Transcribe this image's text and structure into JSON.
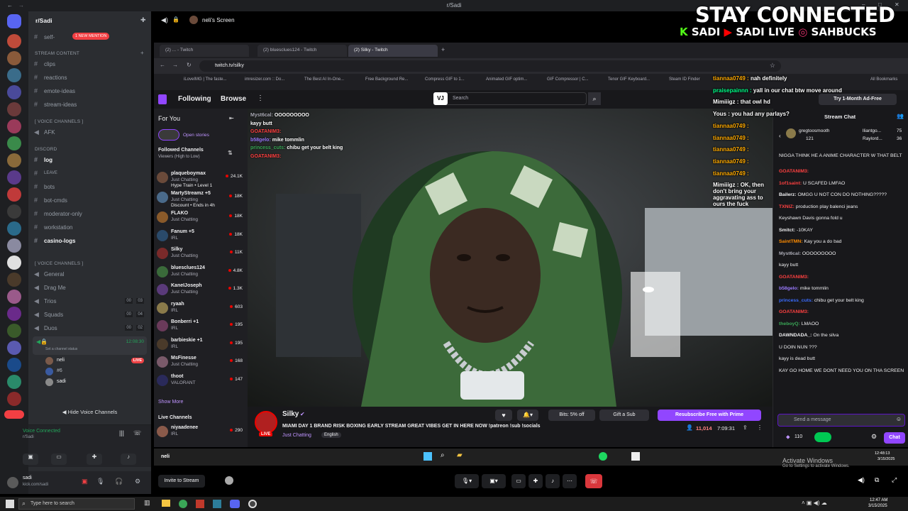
{
  "window": {
    "title": "r/Sadi"
  },
  "server": {
    "name": "r/Sadi",
    "mention_badge": "1 NEW MENTION"
  },
  "channels": {
    "self": "self-",
    "stream_content_category": "Stream Content",
    "stream_content": [
      "clips",
      "reactions",
      "emote-ideas",
      "stream-ideas"
    ],
    "voice_cat_1": "[ VOICE CHANNELS ]",
    "afk": "AFK",
    "discord_category": "Discord",
    "discord_items": [
      "log",
      "LEAVE",
      "bots",
      "bot-cmds",
      "moderator-only",
      "workstation",
      "casino-logs"
    ],
    "voice_cat_2": "[ VOICE CHANNELS ]",
    "voice_items": [
      {
        "name": "General",
        "counts": [
          "",
          ""
        ]
      },
      {
        "name": "Drag Me",
        "counts": [
          "",
          ""
        ]
      },
      {
        "name": "Trios",
        "counts": [
          "00",
          "03"
        ]
      },
      {
        "name": "Squads",
        "counts": [
          "00",
          "04"
        ]
      },
      {
        "name": "Duos",
        "counts": [
          "00",
          "02"
        ]
      }
    ],
    "locked_timer": "12:08:30",
    "set_status": "Set a channel status",
    "members": [
      {
        "name": "neli",
        "live": "LIVE"
      },
      {
        "name": "#6"
      },
      {
        "name": "sadi"
      }
    ],
    "hide_voice": "Hide Voice Channels",
    "voice_connected": "Voice Connected",
    "voice_server": "r/Sadi",
    "user_name": "sadi",
    "user_status": "kick.com/sadi"
  },
  "stage": {
    "screen_title": "neli's Screen",
    "stream_label": "neli",
    "invite": "Invite to Stream"
  },
  "overlay": {
    "headline": "STAY CONNECTED",
    "links": [
      "SADI",
      "SADI LIVE",
      "SAHBUCKS"
    ]
  },
  "browser": {
    "tabs": [
      "(2) ... - Twitch",
      "(2) bluesclues124 - Twitch",
      "(2) Silky - Twitch"
    ],
    "url": "twitch.tv/silky",
    "bookmarks": [
      "iLoveIMG | The faste...",
      "imresizer.com :: Do...",
      "The Best AI In-One...",
      "Free Background Re...",
      "Compress GIF to 1...",
      "Animated GIF optim...",
      "GIF Compressor | C...",
      "Tenor GIF Keyboard...",
      "Steam ID Finder",
      "All Bookmarks"
    ]
  },
  "twitch": {
    "nav": {
      "following": "Following",
      "browse": "Browse",
      "search": "Search",
      "ad_free": "Try 1-Month Ad-Free"
    },
    "for_you": "For You",
    "open_stories": "Open stories",
    "followed": "Followed Channels",
    "sort": "Viewers (High to Low)",
    "follows": [
      {
        "name": "plaqueboymax",
        "game": "Just Chatting",
        "extra": "Hype Train • Level 1",
        "viewers": "24.1K"
      },
      {
        "name": "MartyStreamz +5",
        "game": "Just Chatting",
        "extra": "Discount • Ends in 4h",
        "viewers": "18K"
      },
      {
        "name": "FLAKO",
        "game": "Just Chatting",
        "extra": "",
        "viewers": "18K"
      },
      {
        "name": "Fanum +5",
        "game": "IRL",
        "extra": "",
        "viewers": "18K"
      },
      {
        "name": "Silky",
        "game": "Just Chatting",
        "extra": "",
        "viewers": "11K"
      },
      {
        "name": "bluesclues124",
        "game": "Just Chatting",
        "extra": "",
        "viewers": "4.8K"
      },
      {
        "name": "KaneIJoseph",
        "game": "Just Chatting",
        "extra": "",
        "viewers": "1.3K"
      },
      {
        "name": "ryaah",
        "game": "IRL",
        "extra": "",
        "viewers": "603"
      },
      {
        "name": "Bonberri +1",
        "game": "IRL",
        "extra": "",
        "viewers": "195"
      },
      {
        "name": "barbieskie +1",
        "game": "IRL",
        "extra": "",
        "viewers": "195"
      },
      {
        "name": "MsFinesse",
        "game": "Just Chatting",
        "extra": "",
        "viewers": "168"
      },
      {
        "name": "thoot",
        "game": "VALORANT",
        "extra": "",
        "viewers": "147"
      }
    ],
    "show_more": "Show More",
    "live_channels": "Live Channels",
    "live_first": {
      "name": "niyaadenee",
      "game": "IRL",
      "viewers": "290"
    },
    "video_chat": [
      {
        "user": "Myst6cal:",
        "text": "OOOOOOOOO",
        "color": "#adadb8"
      },
      {
        "user": "",
        "text": "kayy butt",
        "color": "#ff4040"
      },
      {
        "user": "GOATANIM3:",
        "text": "",
        "color": "#ff4040"
      },
      {
        "user": "b58gelo:",
        "text": "mike tommlin",
        "color": "#9b7bff"
      },
      {
        "user": "princess_cuts:",
        "text": "chibu get your belt king",
        "color": "#3aa757"
      },
      {
        "user": "GOATANIM3:",
        "text": "",
        "color": "#ff4040"
      }
    ],
    "streamer": "Silky",
    "stream_title": "MIAMI DAY 1 BRAND RISK BOXING EARLY STREAM GREAT VIBES GET IN HERE NOW !patreon !sub !socials",
    "category": "Just Chatting",
    "language": "English",
    "bits": "Bits: 5% off",
    "gift": "Gift a Sub",
    "resub": "Resubscribe Free with Prime",
    "viewers": "11,014",
    "uptime": "7:09:31",
    "stream_chat_title": "Stream Chat",
    "leaderboard": [
      {
        "name": "gregtoosmooth",
        "val": "121"
      },
      {
        "name": "lliantgo...",
        "val": "75"
      },
      {
        "name": "Raylord...",
        "val": "36"
      }
    ],
    "chat": [
      {
        "user": "",
        "text": "NIGGA THINK HE A ANIME CHARACTER W THAT BELT",
        "color": "#ff4040"
      },
      {
        "user": "GOATANIM3:",
        "text": "",
        "color": "#ff4040"
      },
      {
        "user": "1of1saint:",
        "text": "U SCAFED LMFAO",
        "color": "#ff4040"
      },
      {
        "user": "Bailerz:",
        "text": "OMGG U NOT CON DO NOTHING?????",
        "color": "#efeff1"
      },
      {
        "user": "TXNIZ:",
        "text": "production play balenci jeans",
        "color": "#ff4040"
      },
      {
        "user": "",
        "text": "Keyshawn Davis gonna fold u",
        "color": "#3a6cff"
      },
      {
        "user": "Smitct:",
        "text": "-10KAY",
        "color": "#efeff1"
      },
      {
        "user": "SaintTMN:",
        "text": "Kay you a do bad",
        "color": "#ff8c00"
      },
      {
        "user": "Myst6cal:",
        "text": "OOOOOOOOO",
        "color": "#adadb8"
      },
      {
        "user": "",
        "text": "kayy butt",
        "color": "#ff4040"
      },
      {
        "user": "GOATANIM3:",
        "text": "",
        "color": "#ff4040"
      },
      {
        "user": "b58gelo:",
        "text": "mike tommlin",
        "color": "#9b7bff"
      },
      {
        "user": "princess_cuts:",
        "text": "chibu get your belt king",
        "color": "#3a6cff"
      },
      {
        "user": "GOATANIM3:",
        "text": "",
        "color": "#ff4040"
      },
      {
        "user": "theboyQ:",
        "text": "LMAOO",
        "color": "#3aa757"
      },
      {
        "user": "DAWNDADA_:",
        "text": "On the silva",
        "color": "#efeff1"
      },
      {
        "user": "",
        "text": "U DOIN NUN ???",
        "color": "#ff4040"
      },
      {
        "user": "",
        "text": "kayy is dead butt",
        "color": "#ff4040"
      },
      {
        "user": "",
        "text": "KAY GO HOME WE DONT NEED YOU ON THA SCREEN",
        "color": "#3a6cff"
      }
    ],
    "send_placeholder": "Send a message",
    "points": "110",
    "chat_button": "Chat"
  },
  "overlay_chat": [
    {
      "user": "tiannaa0749 :",
      "text": "nah definitely",
      "color": "#ffaa00"
    },
    {
      "user": "praisepainnn :",
      "text": "yall in our chat btw move around",
      "color": "#00ff88"
    },
    {
      "user": "Mimiiigz :",
      "text": "that owl hd",
      "color": "#ffffff"
    },
    {
      "user": "Yous :",
      "text": "you had any parlays?",
      "color": "#ffffff"
    },
    {
      "user": "tiannaa0749 :",
      "text": "",
      "color": "#ffaa00"
    },
    {
      "user": "tiannaa0749 :",
      "text": "",
      "color": "#ffaa00"
    },
    {
      "user": "tiannaa0749 :",
      "text": "",
      "color": "#ffaa00"
    },
    {
      "user": "tiannaa0749 :",
      "text": "",
      "color": "#ffaa00"
    },
    {
      "user": "tiannaa0749 :",
      "text": "",
      "color": "#ffaa00"
    },
    {
      "user": "Mimiiigz :",
      "text": "OK, then don't bring your aggravating ass to ours the fuck",
      "color": "#ffffff"
    }
  ],
  "windows_overlay": {
    "activate": "Activate Windows",
    "activate_sub": "Go to Settings to activate Windows.",
    "clock": "12:48:13",
    "date": "3/15/2025"
  },
  "taskbar": {
    "search": "Type here to search",
    "time": "12:47 AM",
    "date": "3/15/2025"
  }
}
